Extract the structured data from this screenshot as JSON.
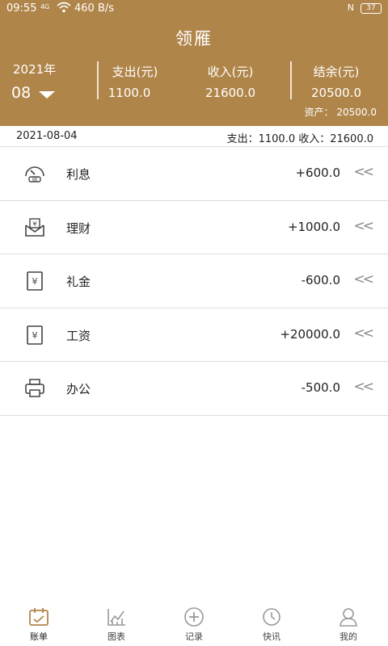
{
  "status_bar": {
    "time": "09:55",
    "signal": "4G",
    "speed": "460 B/s",
    "nfc": "N",
    "battery": "37"
  },
  "header": {
    "title": "领雁",
    "year": "2021年",
    "month": "08",
    "expense_label": "支出(元)",
    "expense_value": "1100.0",
    "income_label": "收入(元)",
    "income_value": "21600.0",
    "balance_label": "结余(元)",
    "balance_value": "20500.0",
    "assets": "资产：  20500.0"
  },
  "day": {
    "date": "2021-08-04",
    "summary": "支出：1100.0 收入：21600.0"
  },
  "records": [
    {
      "label": "利息",
      "amount": "+600.0",
      "icon": "meter-icon"
    },
    {
      "label": "理财",
      "amount": "+1000.0",
      "icon": "finance-icon"
    },
    {
      "label": "礼金",
      "amount": "-600.0",
      "icon": "yuan-icon"
    },
    {
      "label": "工资",
      "amount": "+20000.0",
      "icon": "yuan-icon"
    },
    {
      "label": "办公",
      "amount": "-500.0",
      "icon": "printer-icon"
    }
  ],
  "tabs": [
    {
      "label": "账单",
      "icon": "calendar-icon",
      "active": true
    },
    {
      "label": "图表",
      "icon": "chart-icon",
      "active": false
    },
    {
      "label": "记录",
      "icon": "plus-circle-icon",
      "active": false
    },
    {
      "label": "快讯",
      "icon": "clock-icon",
      "active": false
    },
    {
      "label": "我的",
      "icon": "user-icon",
      "active": false
    }
  ],
  "colors": {
    "brand": "#b08549",
    "active_tab": "#b08549"
  }
}
